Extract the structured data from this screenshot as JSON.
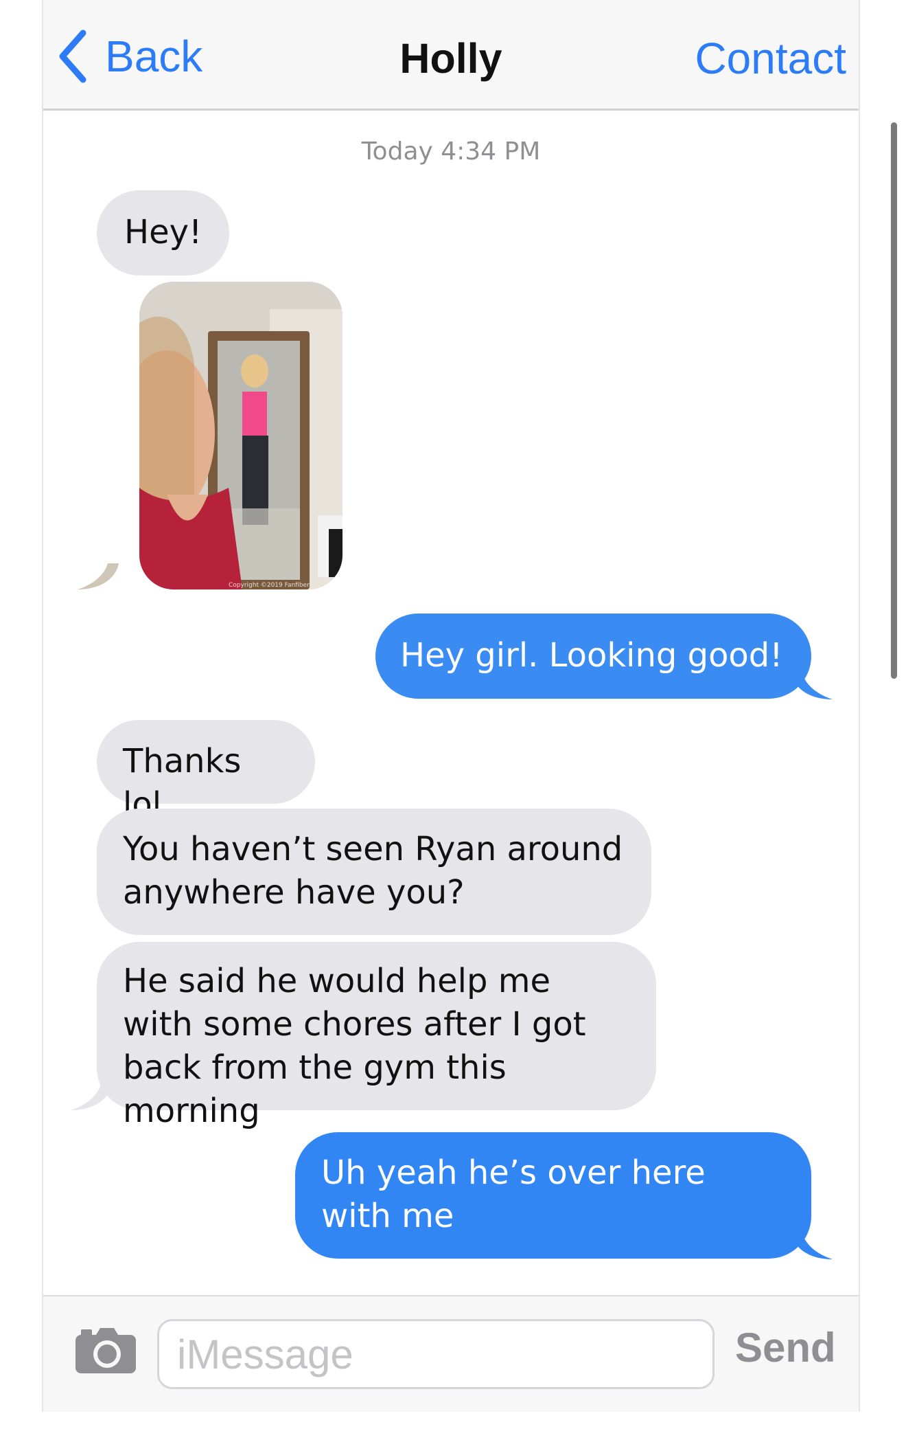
{
  "navbar": {
    "back_label": "Back",
    "title": "Holly",
    "contact_label": "Contact"
  },
  "thread": {
    "timestamp": "Today 4:34 PM",
    "messages": [
      {
        "from": "them",
        "text": "Hey!"
      },
      {
        "from": "them",
        "type": "photo",
        "watermark": "Copyright ©2019 Fanfiber"
      },
      {
        "from": "me",
        "text": "Hey girl. Looking good!"
      },
      {
        "from": "them",
        "text": "Thanks lol"
      },
      {
        "from": "them",
        "text": "You haven’t seen Ryan around anywhere have you?"
      },
      {
        "from": "them",
        "text": "He said he would help me with some chores after I got back from the gym this morning"
      },
      {
        "from": "me",
        "text": "Uh yeah he’s over here with me"
      }
    ]
  },
  "input": {
    "placeholder": "iMessage",
    "value": "",
    "send_label": "Send",
    "camera_icon": "camera-icon"
  },
  "colors": {
    "accent": "#2b7cf6",
    "outgoing_bubble": "#3b8cf2",
    "incoming_bubble": "#e5e5ea"
  }
}
